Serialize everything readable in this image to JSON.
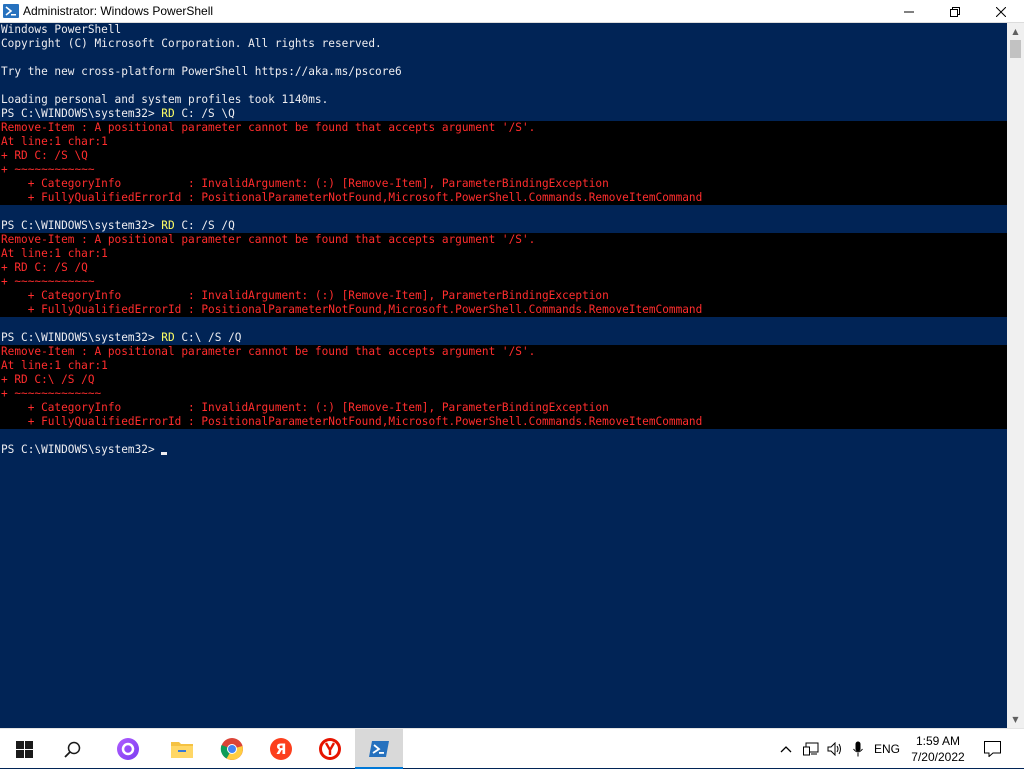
{
  "window": {
    "title": "Administrator: Windows PowerShell",
    "minimize_glyph": "—",
    "maximize_glyph": "❐",
    "close_glyph": "✕"
  },
  "console": {
    "lines": [
      {
        "text": "Windows PowerShell",
        "style": "normal"
      },
      {
        "text": "Copyright (C) Microsoft Corporation. All rights reserved.",
        "style": "normal"
      },
      {
        "text": "",
        "style": "normal"
      },
      {
        "text": "Try the new cross-platform PowerShell https://aka.ms/pscore6",
        "style": "normal"
      },
      {
        "text": "",
        "style": "normal"
      },
      {
        "text": "Loading personal and system profiles took 1140ms.",
        "style": "normal"
      },
      {
        "prompt": "PS C:\\WINDOWS\\system32> ",
        "keyword": "RD",
        "args": " C: /S \\Q",
        "style": "prompt"
      },
      {
        "text": "Remove-Item : A positional parameter cannot be found that accepts argument '/S'.",
        "style": "error"
      },
      {
        "text": "At line:1 char:1",
        "style": "error"
      },
      {
        "text": "+ RD C: /S \\Q",
        "style": "error"
      },
      {
        "text": "+ ~~~~~~~~~~~~",
        "style": "error"
      },
      {
        "text": "    + CategoryInfo          : InvalidArgument: (:) [Remove-Item], ParameterBindingException",
        "style": "error"
      },
      {
        "text": "    + FullyQualifiedErrorId : PositionalParameterNotFound,Microsoft.PowerShell.Commands.RemoveItemCommand",
        "style": "error"
      },
      {
        "text": "",
        "style": "normal"
      },
      {
        "prompt": "PS C:\\WINDOWS\\system32> ",
        "keyword": "RD",
        "args": " C: /S /Q",
        "style": "prompt"
      },
      {
        "text": "Remove-Item : A positional parameter cannot be found that accepts argument '/S'.",
        "style": "error"
      },
      {
        "text": "At line:1 char:1",
        "style": "error"
      },
      {
        "text": "+ RD C: /S /Q",
        "style": "error"
      },
      {
        "text": "+ ~~~~~~~~~~~~",
        "style": "error"
      },
      {
        "text": "    + CategoryInfo          : InvalidArgument: (:) [Remove-Item], ParameterBindingException",
        "style": "error"
      },
      {
        "text": "    + FullyQualifiedErrorId : PositionalParameterNotFound,Microsoft.PowerShell.Commands.RemoveItemCommand",
        "style": "error"
      },
      {
        "text": "",
        "style": "normal"
      },
      {
        "prompt": "PS C:\\WINDOWS\\system32> ",
        "keyword": "RD",
        "args": " C:\\ /S /Q",
        "style": "prompt"
      },
      {
        "text": "Remove-Item : A positional parameter cannot be found that accepts argument '/S'.",
        "style": "error"
      },
      {
        "text": "At line:1 char:1",
        "style": "error"
      },
      {
        "text": "+ RD C:\\ /S /Q",
        "style": "error"
      },
      {
        "text": "+ ~~~~~~~~~~~~~",
        "style": "error"
      },
      {
        "text": "    + CategoryInfo          : InvalidArgument: (:) [Remove-Item], ParameterBindingException",
        "style": "error"
      },
      {
        "text": "    + FullyQualifiedErrorId : PositionalParameterNotFound,Microsoft.PowerShell.Commands.RemoveItemCommand",
        "style": "error"
      },
      {
        "text": "",
        "style": "normal"
      },
      {
        "prompt": "PS C:\\WINDOWS\\system32> ",
        "keyword": "",
        "args": "",
        "style": "current"
      }
    ],
    "colors": {
      "background": "#012456",
      "foreground": "#eeedf0",
      "error_fg": "#ff2d2d",
      "error_bg": "#000000",
      "keyword": "#ffff66"
    }
  },
  "taskbar": {
    "apps": [
      {
        "name": "start-button",
        "icon": "windows-logo-icon"
      },
      {
        "name": "search-button",
        "icon": "search-icon"
      },
      {
        "name": "alice-button",
        "icon": "alice-assistant-icon"
      },
      {
        "name": "file-explorer-button",
        "icon": "folder-icon"
      },
      {
        "name": "chrome-button",
        "icon": "chrome-icon"
      },
      {
        "name": "yandex-button",
        "icon": "yandex-icon"
      },
      {
        "name": "yandex-browser-button",
        "icon": "yandex-browser-icon"
      },
      {
        "name": "powershell-button",
        "icon": "powershell-icon",
        "active": true
      }
    ],
    "tray": {
      "language": "ENG",
      "time": "1:59 AM",
      "date": "7/20/2022"
    },
    "accent": "#0078d7"
  }
}
